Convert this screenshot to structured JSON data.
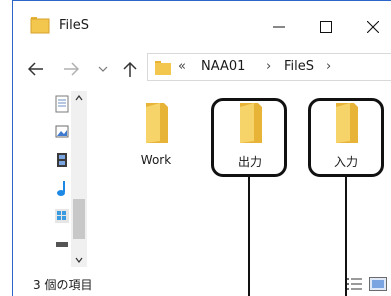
{
  "window": {
    "title": "FileS"
  },
  "caption_buttons": {
    "minimize_icon": "minimize-icon",
    "maximize_icon": "maximize-icon",
    "close_icon": "close-icon"
  },
  "navigation": {
    "back_icon": "arrow-left-icon",
    "forward_icon": "arrow-right-icon",
    "recent_icon": "chevron-down-icon",
    "up_icon": "arrow-up-icon"
  },
  "address": {
    "overflow": "«",
    "path": [
      "NAA01",
      "FileS"
    ],
    "separator": "›",
    "dropdown": "⌄"
  },
  "files": [
    {
      "name": "Work",
      "icon": "folder-icon"
    },
    {
      "name": "出力",
      "icon": "folder-icon"
    },
    {
      "name": "入力",
      "icon": "folder-icon"
    }
  ],
  "status": {
    "item_count": "3 個の項目"
  },
  "colors": {
    "folder": "#f3c74e",
    "folder_shade": "#e8b437",
    "accent": "#2b66c8",
    "callout": "#111111"
  }
}
